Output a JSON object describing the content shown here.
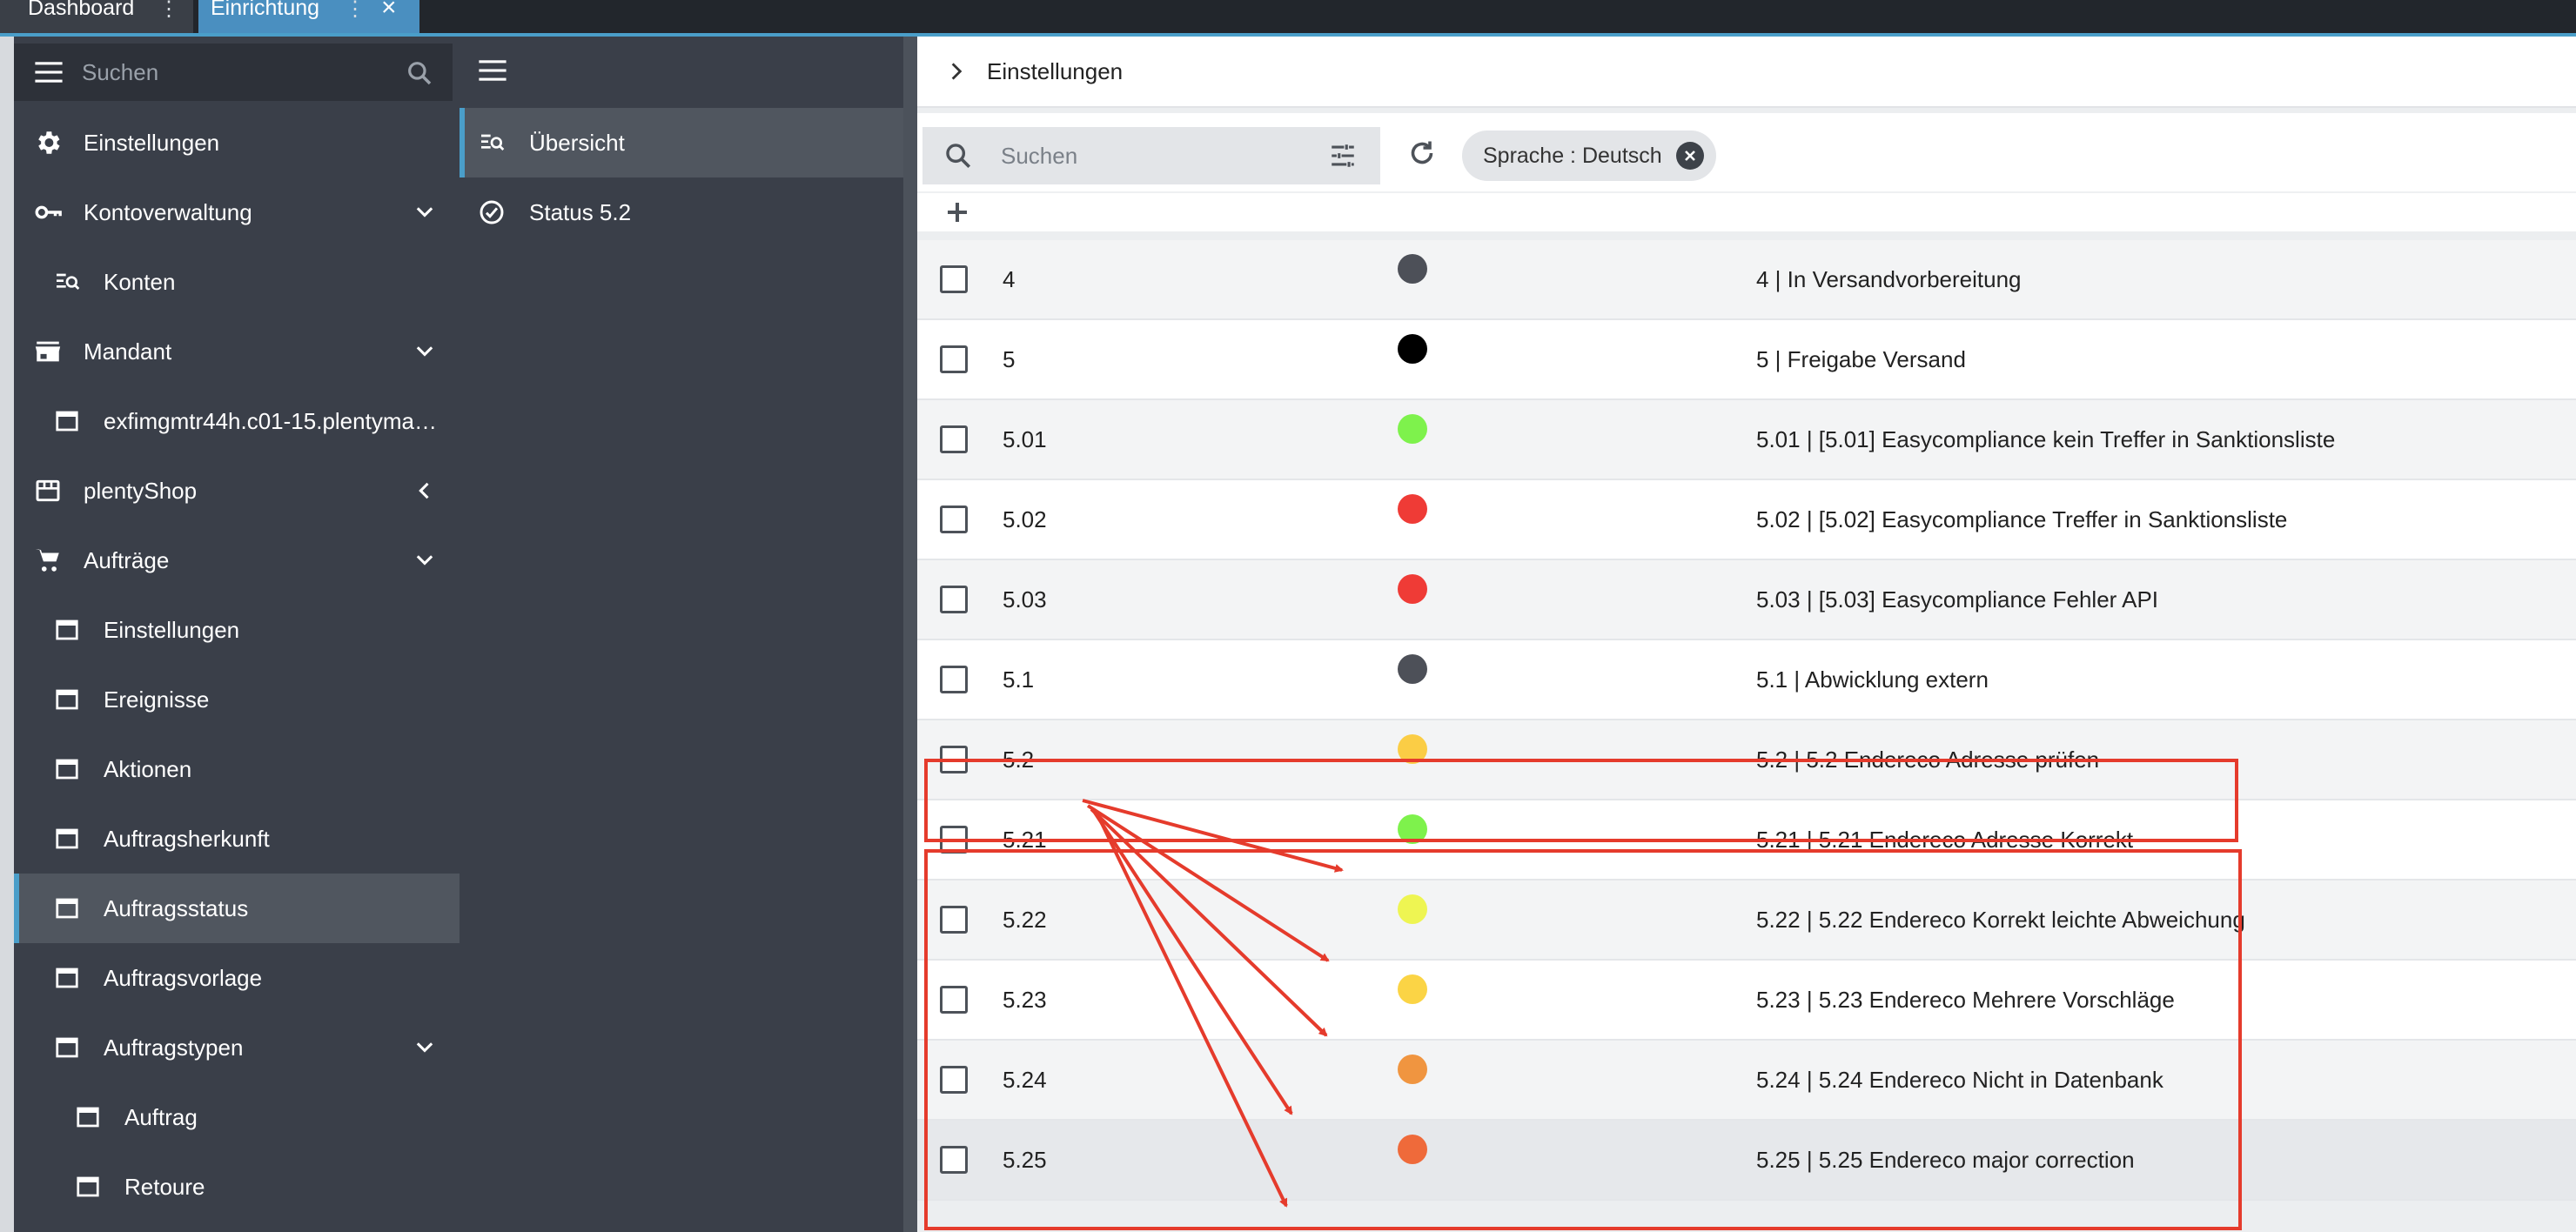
{
  "tabs": [
    {
      "label": "Dashboard"
    },
    {
      "label": "Einrichtung"
    }
  ],
  "sidebar": {
    "search_placeholder": "Suchen",
    "items": [
      {
        "label": "Einstellungen",
        "icon": "gear-icon"
      },
      {
        "label": "Kontoverwaltung",
        "icon": "key-icon"
      },
      {
        "label": "Konten",
        "icon": "list-search-icon"
      },
      {
        "label": "Mandant",
        "icon": "store-icon"
      },
      {
        "label": "exfimgmtr44h.c01-15.plentyma…",
        "icon": "window-icon"
      },
      {
        "label": "plentyShop",
        "icon": "shop-icon"
      },
      {
        "label": "Aufträge",
        "icon": "cart-icon"
      },
      {
        "label": "Einstellungen",
        "icon": "window-icon"
      },
      {
        "label": "Ereignisse",
        "icon": "window-icon"
      },
      {
        "label": "Aktionen",
        "icon": "window-icon"
      },
      {
        "label": "Auftragsherkunft",
        "icon": "window-icon"
      },
      {
        "label": "Auftragsstatus",
        "icon": "window-icon"
      },
      {
        "label": "Auftragsvorlage",
        "icon": "window-icon"
      },
      {
        "label": "Auftragstypen",
        "icon": "window-icon"
      },
      {
        "label": "Auftrag",
        "icon": "window-icon"
      },
      {
        "label": "Retoure",
        "icon": "window-icon"
      }
    ]
  },
  "middle": {
    "items": [
      {
        "label": "Übersicht",
        "icon": "list-search-icon"
      },
      {
        "label": "Status 5.2",
        "icon": "check-circle-icon"
      }
    ]
  },
  "main": {
    "breadcrumb": "Einstellungen",
    "search_placeholder": "Suchen",
    "filter_chip": "Sprache : Deutsch",
    "rows": [
      {
        "id": "4",
        "color": "#4d5058",
        "name": "4 | In Versandvorbereitung"
      },
      {
        "id": "5",
        "color": "#000000",
        "name": "5 | Freigabe Versand"
      },
      {
        "id": "5.01",
        "color": "#7ef24c",
        "name": "5.01 | [5.01] Easycompliance kein Treffer in Sanktionsliste"
      },
      {
        "id": "5.02",
        "color": "#ef3b36",
        "name": "5.02 | [5.02] Easycompliance Treffer in Sanktionsliste"
      },
      {
        "id": "5.03",
        "color": "#ef3b36",
        "name": "5.03 | [5.03] Easycompliance Fehler API"
      },
      {
        "id": "5.1",
        "color": "#4d5058",
        "name": "5.1 | Abwicklung extern"
      },
      {
        "id": "5.2",
        "color": "#fbcd45",
        "name": "5.2 | 5.2 Endereco Adresse prüfen"
      },
      {
        "id": "5.21",
        "color": "#7ef24c",
        "name": "5.21 | 5.21 Endereco Adresse Korrekt"
      },
      {
        "id": "5.22",
        "color": "#eef552",
        "name": "5.22 | 5.22 Endereco Korrekt leichte Abweichung"
      },
      {
        "id": "5.23",
        "color": "#fbd445",
        "name": "5.23 | 5.23 Endereco Mehrere Vorschläge"
      },
      {
        "id": "5.24",
        "color": "#f09540",
        "name": "5.24 | 5.24 Endereco Nicht in Datenbank"
      },
      {
        "id": "5.25",
        "color": "#ef6a3a",
        "name": "5.25 | 5.25 Endereco major correction"
      }
    ]
  },
  "colors": {
    "accent": "#4a9ec9",
    "sidebar": "#3a3f49",
    "annotation": "#e53b2c"
  }
}
